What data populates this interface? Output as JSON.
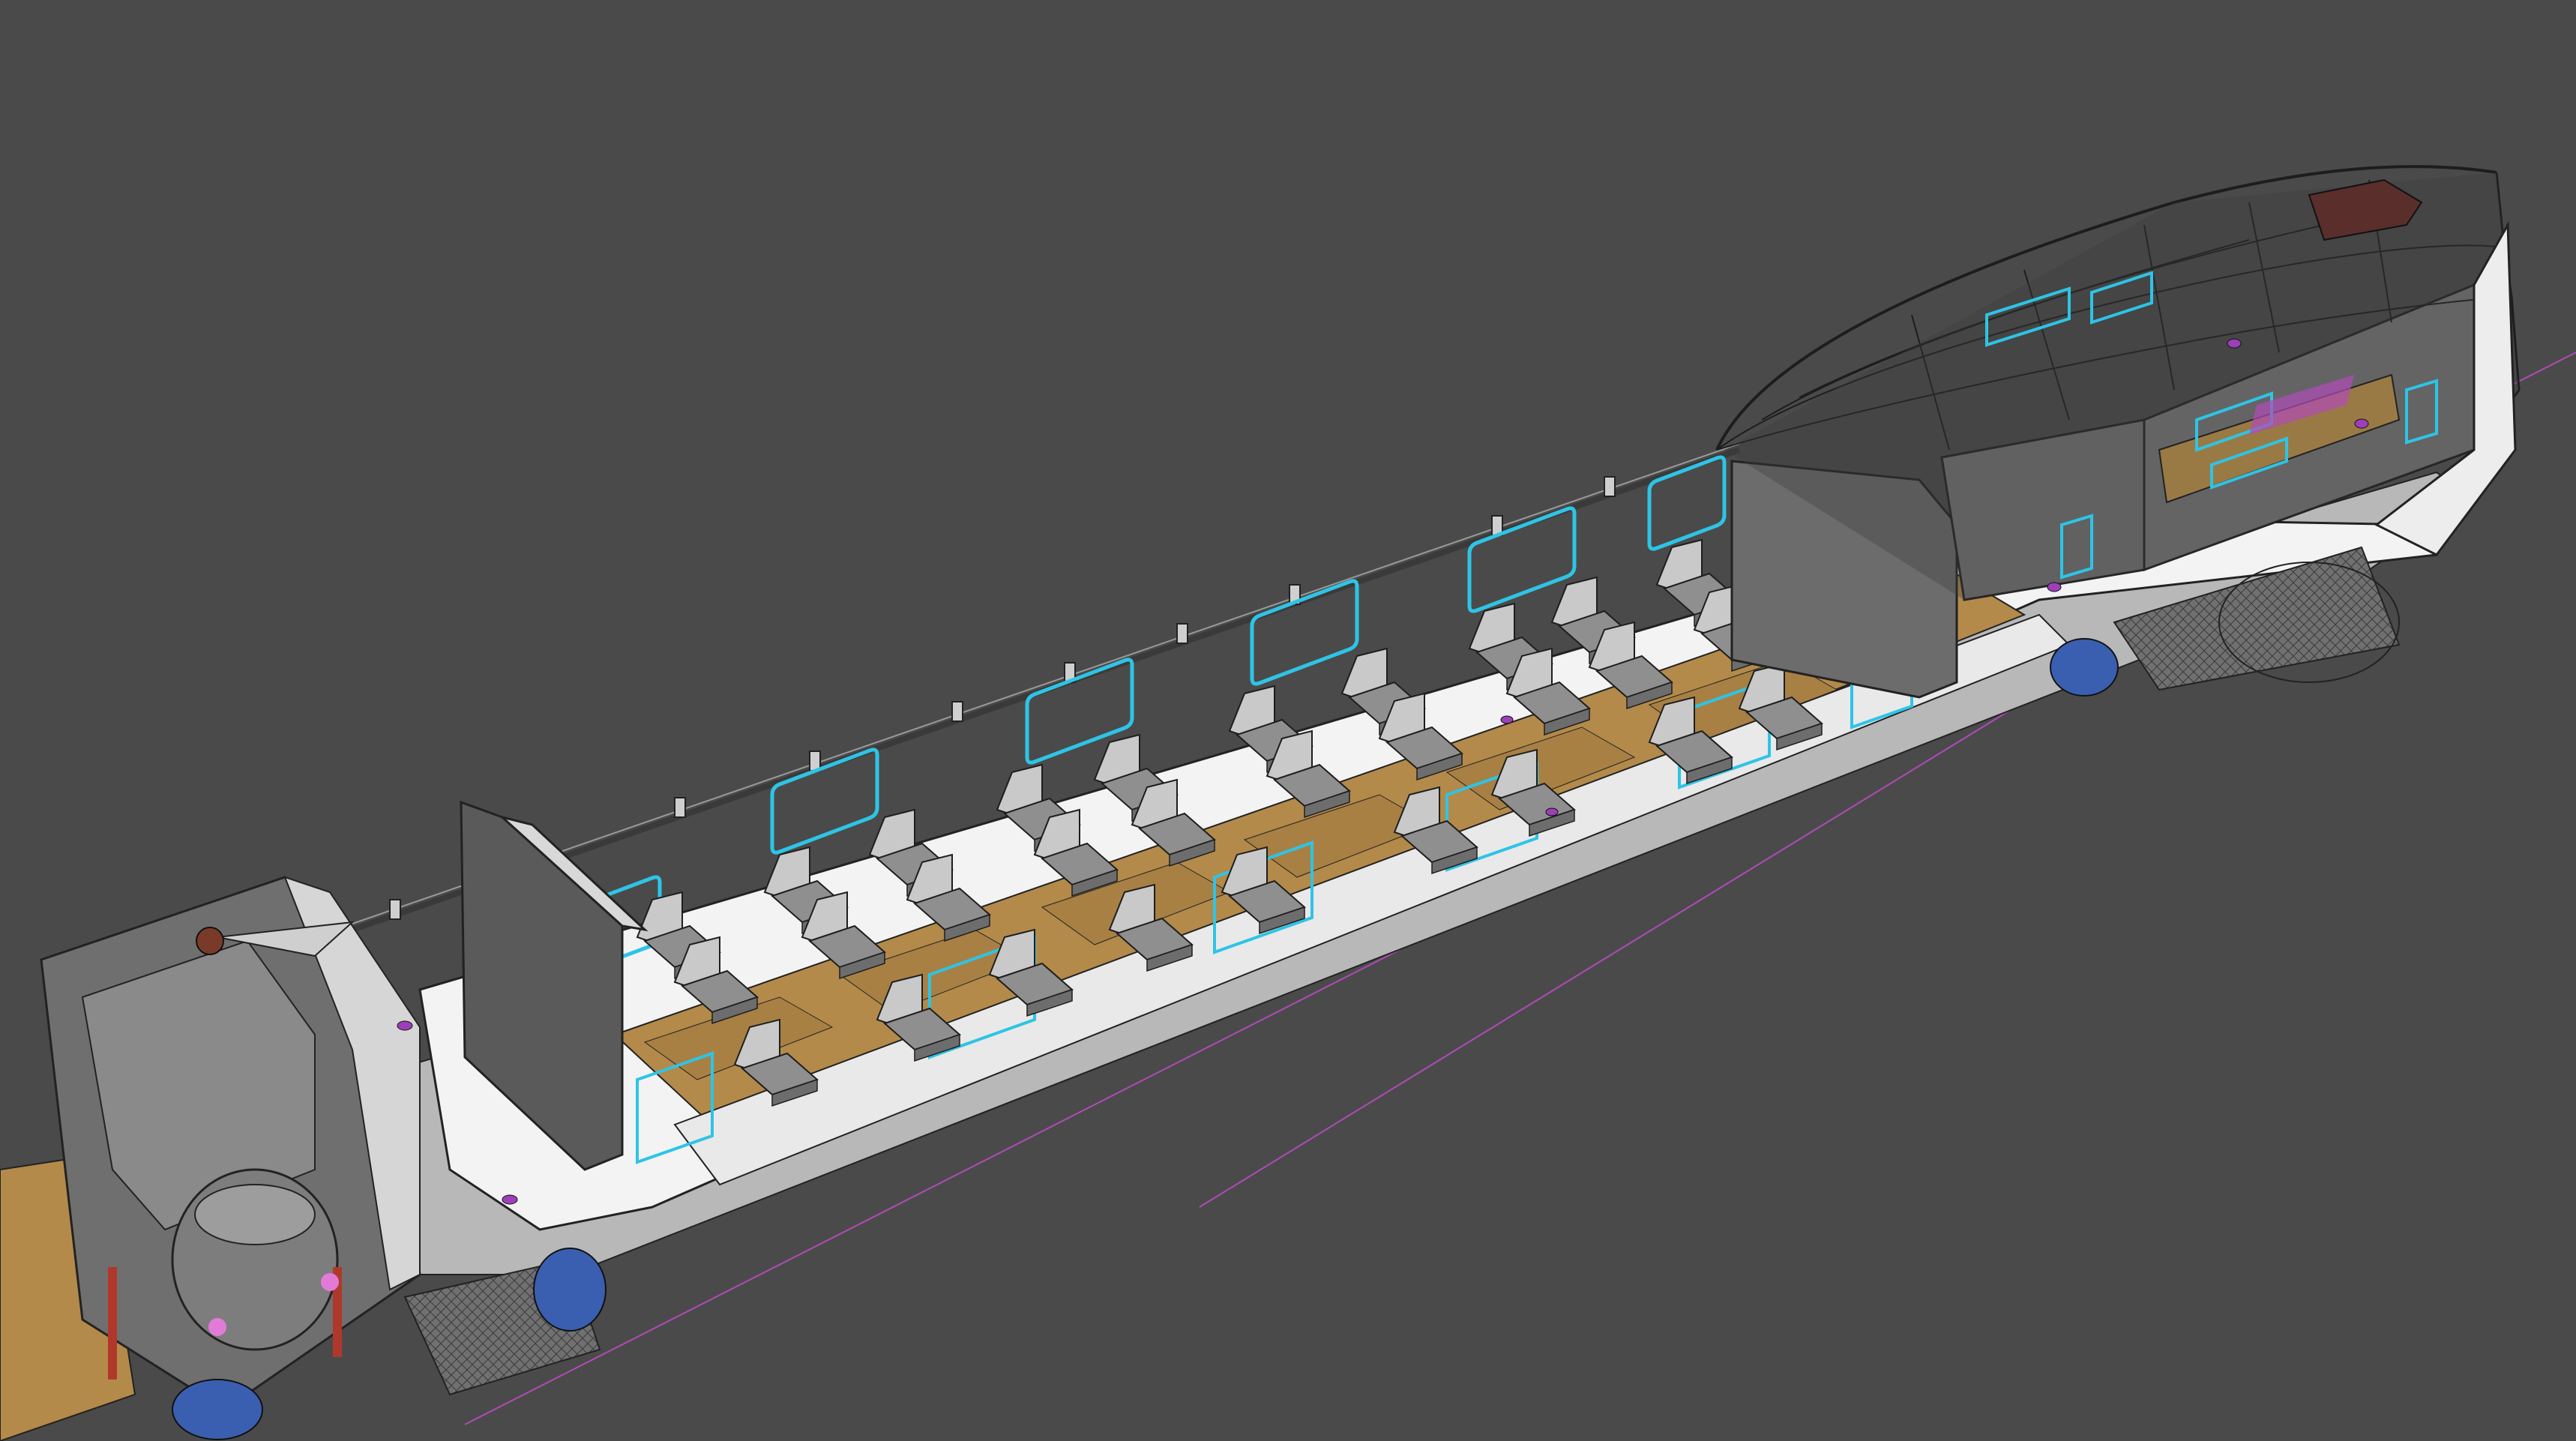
{
  "viewport": {
    "background": "#4a4a4a"
  },
  "colors": {
    "shell_white": "#f2f2f2",
    "shell_grey": "#b9b9b9",
    "floor_tan": "#b38a4a",
    "partition_dark": "#5a5a5a",
    "wire": "#2a2a2a",
    "glass_cyan": "#2ec4e6",
    "seat_grey": "#8f8f8f",
    "seat_light": "#c9c9c9",
    "helper_magenta": "#b04bb7",
    "marker_violet": "#9c3fb8",
    "bogie_dark": "#6a6a6a",
    "wheel_blue": "#3a5fb0",
    "spring_red": "#b0382a",
    "pink_marker": "#e27bd7"
  },
  "icons": {
    "seat": "armchair",
    "window": "rounded-rect-outline",
    "bogie": "wheel-assembly",
    "pantograph": "pantograph"
  }
}
